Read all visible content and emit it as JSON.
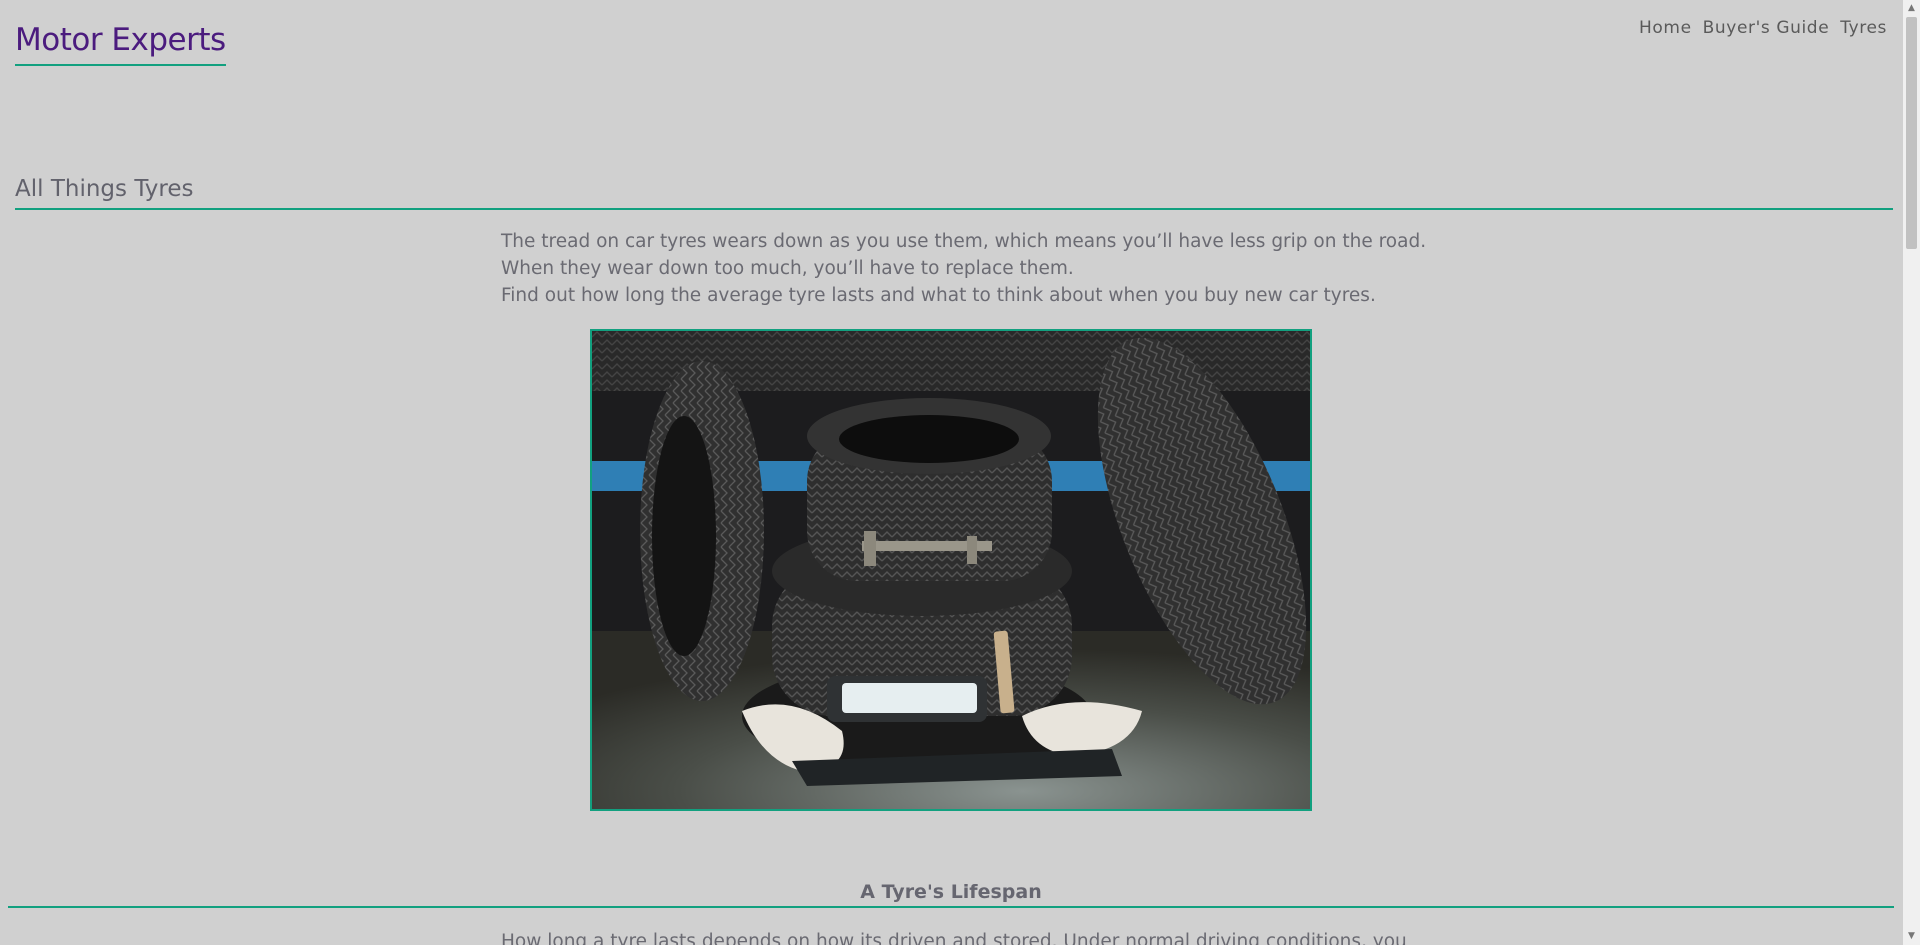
{
  "header": {
    "brand": "Motor Experts",
    "nav": [
      "Home",
      "Buyer's Guide",
      "Tyres"
    ]
  },
  "main": {
    "title": "All Things Tyres",
    "intro": [
      "The tread on car tyres wears down as you use them, which means you’ll have less grip on the road.",
      "When they wear down too much, you’ll have to replace them.",
      "Find out how long the average tyre lasts and what to think about when you buy new car tyres."
    ],
    "lifespan_title": "A Tyre's Lifespan",
    "lifespan_text": "How long a tyre lasts depends on how its driven and stored. Under normal driving conditions, you"
  },
  "colors": {
    "background": "#d0d0d0",
    "brand": "#4b1b7e",
    "accent": "#12a07f",
    "text": "#6a6a72"
  }
}
